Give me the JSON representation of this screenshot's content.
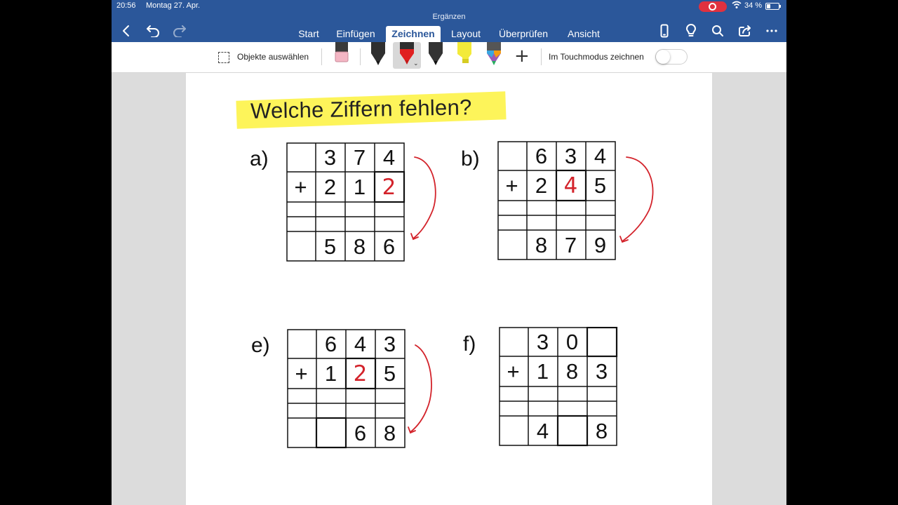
{
  "status_bar": {
    "time": "20:56",
    "date": "Montag 27. Apr.",
    "battery": "34 %"
  },
  "app": {
    "document_title": "Ergänzen",
    "tabs": [
      {
        "label": "Start"
      },
      {
        "label": "Einfügen"
      },
      {
        "label": "Zeichnen",
        "active": true
      },
      {
        "label": "Layout"
      },
      {
        "label": "Überprüfen"
      },
      {
        "label": "Ansicht"
      }
    ],
    "colors": {
      "ribbon": "#2b579a",
      "annotation_red": "#d3232b",
      "highlight_yellow": "#fdf45a"
    }
  },
  "toolbar": {
    "select_objects": "Objekte auswählen",
    "touch_mode": "Im Touchmodus zeichnen",
    "touch_mode_on": false
  },
  "worksheet": {
    "heading": "Welche Ziffern fehlen?",
    "tasks": [
      {
        "label": "a)",
        "top": [
          "3",
          "7",
          "4"
        ],
        "operator": "+",
        "addend": [
          "2",
          "1",
          "2"
        ],
        "sum": [
          "5",
          "8",
          "6"
        ]
      },
      {
        "label": "b)",
        "top": [
          "6",
          "3",
          "4"
        ],
        "operator": "+",
        "addend": [
          "2",
          "4",
          "5"
        ],
        "sum": [
          "8",
          "7",
          "9"
        ]
      },
      {
        "label": "e)",
        "top": [
          "6",
          "4",
          "3"
        ],
        "operator": "+",
        "addend": [
          "1",
          "2",
          "5"
        ],
        "sum": [
          "",
          "6",
          "8"
        ]
      },
      {
        "label": "f)",
        "top": [
          "3",
          "0",
          ""
        ],
        "operator": "+",
        "addend": [
          "1",
          "8",
          "3"
        ],
        "sum": [
          "4",
          "",
          "8"
        ]
      }
    ]
  }
}
